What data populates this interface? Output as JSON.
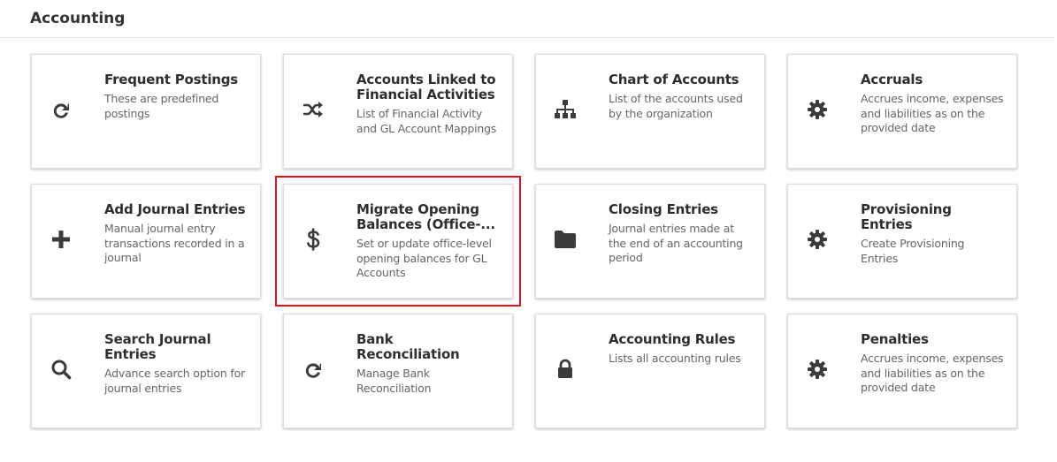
{
  "page": {
    "title": "Accounting"
  },
  "cards": [
    {
      "title": "Frequent Postings",
      "description": "These are predefined postings",
      "icon": "refresh-icon"
    },
    {
      "title": "Accounts Linked to Financial Activities",
      "description": "List of Financial Activity and GL Account Mappings",
      "icon": "shuffle-icon"
    },
    {
      "title": "Chart of Accounts",
      "description": "List of the accounts used by the organization",
      "icon": "sitemap-icon"
    },
    {
      "title": "Accruals",
      "description": "Accrues income, expenses and liabilities as on the provided date",
      "icon": "gear-icon"
    },
    {
      "title": "Add Journal Entries",
      "description": "Manual journal entry transactions recorded in a journal",
      "icon": "plus-icon"
    },
    {
      "title": "Migrate Opening Balances (Office-...",
      "description": "Set or update office-level opening balances for GL Accounts",
      "icon": "dollar-icon",
      "selected": true
    },
    {
      "title": "Closing Entries",
      "description": "Journal entries made at the end of an accounting period",
      "icon": "folder-icon"
    },
    {
      "title": "Provisioning Entries",
      "description": "Create Provisioning Entries",
      "icon": "gear-icon"
    },
    {
      "title": "Search Journal Entries",
      "description": "Advance search option for journal entries",
      "icon": "search-icon"
    },
    {
      "title": "Bank Reconciliation",
      "description": "Manage Bank Reconciliation",
      "icon": "refresh-icon"
    },
    {
      "title": "Accounting Rules",
      "description": "Lists all accounting rules",
      "icon": "lock-icon"
    },
    {
      "title": "Penalties",
      "description": "Accrues income, expenses and liabilities as on the provided date",
      "icon": "gear-icon"
    }
  ],
  "colors": {
    "selection_outline": "#e3131b",
    "icon": "#3b3b3b"
  }
}
